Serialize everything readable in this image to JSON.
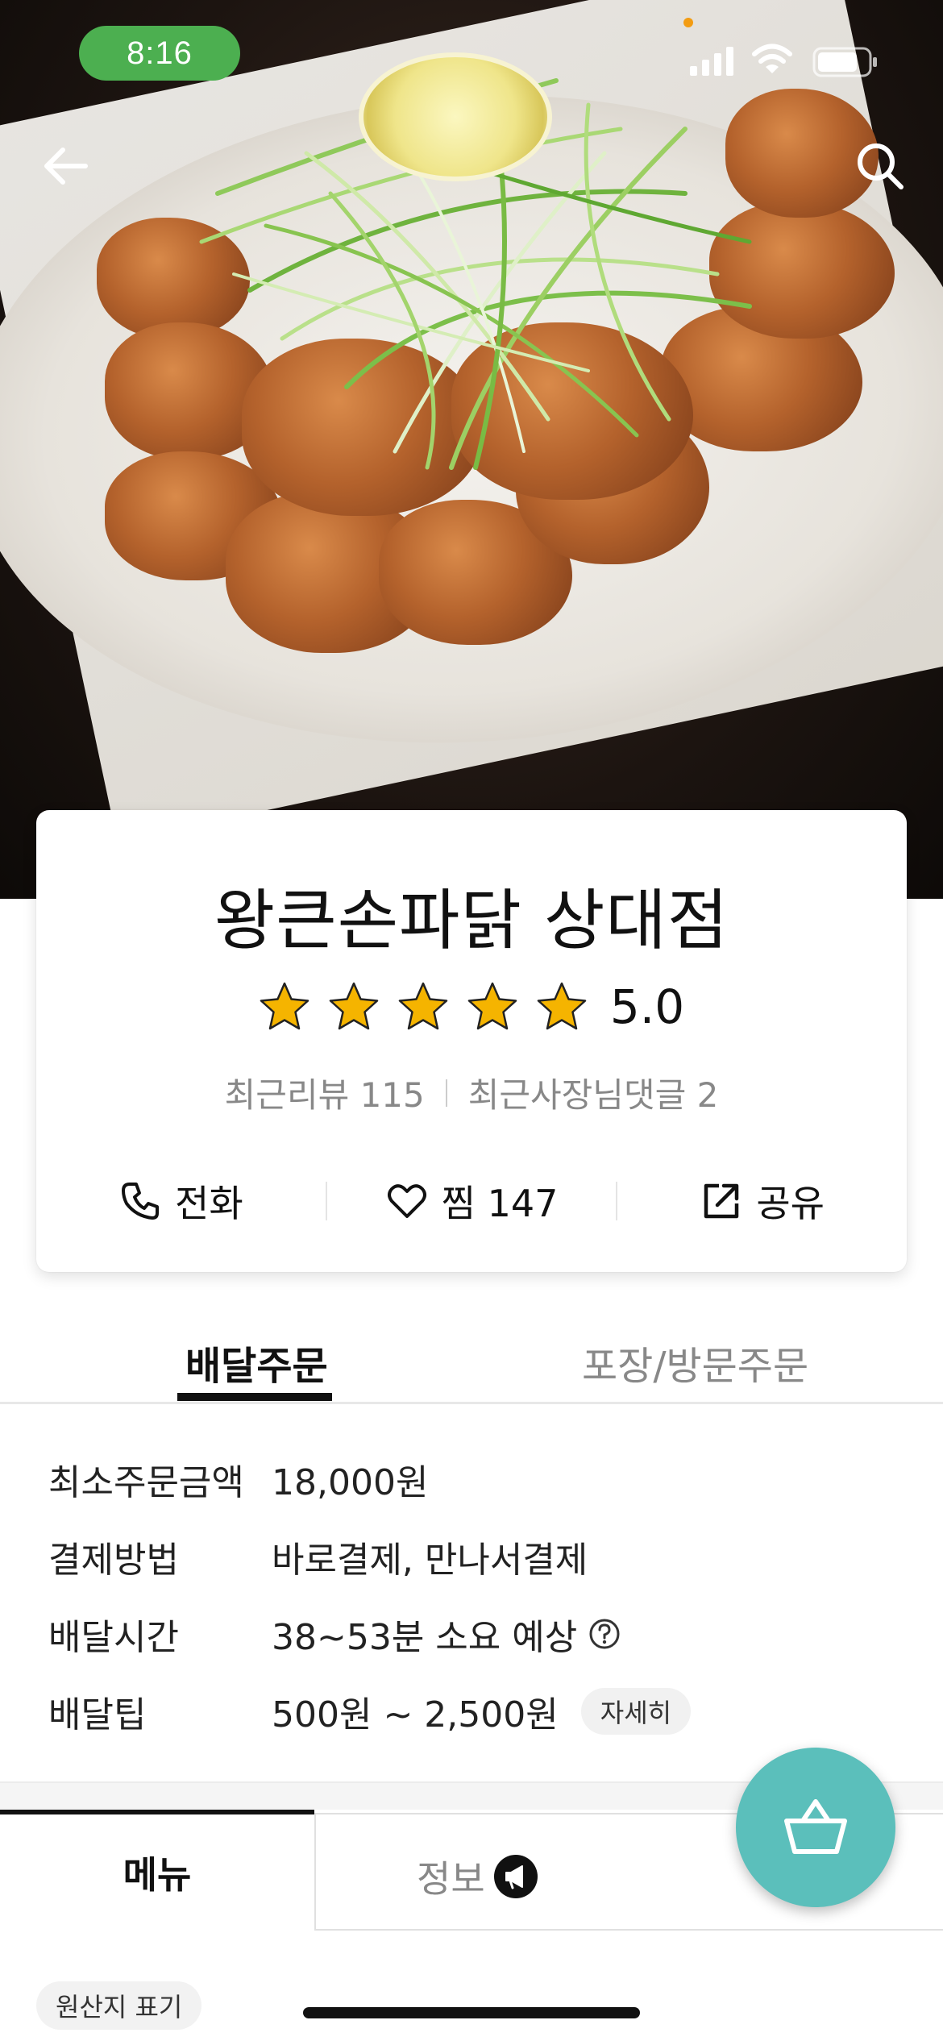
{
  "status_bar": {
    "time": "8:16"
  },
  "store": {
    "name": "왕큰손파닭 상대점",
    "rating": "5.0",
    "stars": 5,
    "recent_reviews": "최근리뷰 115",
    "owner_replies": "최근사장님댓글 2"
  },
  "actions": {
    "call": "전화",
    "favorite": "찜 147",
    "share": "공유"
  },
  "order_tabs": {
    "delivery": "배달주문",
    "pickup": "포장/방문주문"
  },
  "delivery_info": {
    "min_order_label": "최소주문금액",
    "min_order_value": "18,000원",
    "payment_label": "결제방법",
    "payment_value": "바로결제, 만나서결제",
    "time_label": "배달시간",
    "time_value": "38~53분 소요 예상",
    "tip_label": "배달팁",
    "tip_value": "500원 ~ 2,500원",
    "tip_detail": "자세히"
  },
  "bottom_tabs": {
    "menu": "메뉴",
    "info": "정보"
  },
  "origin_chip": "원산지 표기",
  "colors": {
    "time_pill": "#4caf50",
    "cart_fab": "#5bbfbb",
    "star": "#f5b400"
  },
  "icons": [
    "back-arrow-icon",
    "search-icon",
    "star-icon",
    "phone-icon",
    "heart-icon",
    "share-icon",
    "question-icon",
    "megaphone-icon",
    "basket-icon"
  ]
}
